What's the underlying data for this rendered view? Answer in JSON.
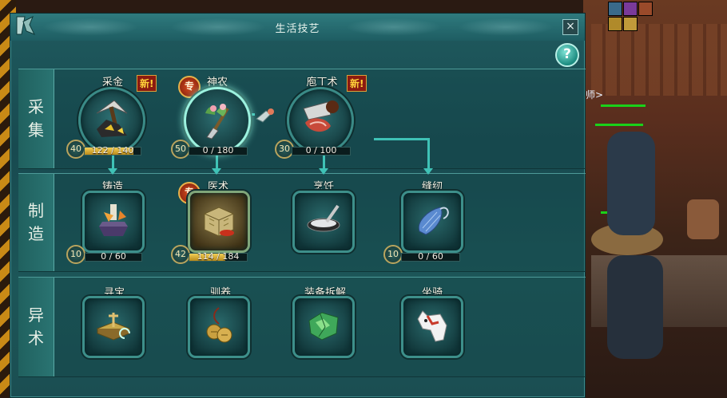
{
  "window": {
    "title": "生活技艺",
    "close_label": "×",
    "help_label": "?"
  },
  "sections": {
    "gather": {
      "label_chars": [
        "采",
        "集"
      ]
    },
    "craft": {
      "label_chars": [
        "制",
        "造"
      ]
    },
    "misc": {
      "label_chars": [
        "异",
        "术"
      ]
    }
  },
  "skills": {
    "mining": {
      "name": "采金",
      "badge": "新!",
      "level": "40",
      "progress_text": "122 / 140",
      "progress": 0.87,
      "icon": "pickaxe-gold-ore-icon"
    },
    "herbal": {
      "name": "神农",
      "badge": "专",
      "level": "50",
      "progress_text": "0 / 180",
      "progress": 0,
      "icon": "herb-shovel-icon"
    },
    "butcher": {
      "name": "庖丁术",
      "badge": "新!",
      "level": "30",
      "progress_text": "0 / 100",
      "progress": 0,
      "icon": "cleaver-meat-icon"
    },
    "forging": {
      "name": "铸造",
      "level": "10",
      "progress_text": "0 / 60",
      "progress": 0,
      "icon": "anvil-hammer-icon"
    },
    "medicine": {
      "name": "医术",
      "badge": "专",
      "level": "42",
      "progress_text": "114 / 184",
      "progress": 0.62,
      "icon": "medicine-bundle-icon"
    },
    "cooking": {
      "name": "烹饪",
      "icon": "wok-icon"
    },
    "sewing": {
      "name": "缝纫",
      "level": "10",
      "progress_text": "0 / 60",
      "progress": 0,
      "icon": "thread-spool-icon"
    },
    "treasure": {
      "name": "寻宝",
      "icon": "treasure-compass-icon"
    },
    "taming": {
      "name": "驯养",
      "icon": "bells-icon"
    },
    "dismantle": {
      "name": "装备拆解",
      "icon": "jade-fragment-icon"
    },
    "mount": {
      "name": "坐骑",
      "icon": "white-horse-icon"
    }
  },
  "background": {
    "npc_text": "师>"
  },
  "colors": {
    "panel": "#1b4e52",
    "accent": "#3fc2b6",
    "progress_fill": "#f3cf58",
    "new_badge": "#ffd23a",
    "hp_bar": "#1ad11a"
  }
}
